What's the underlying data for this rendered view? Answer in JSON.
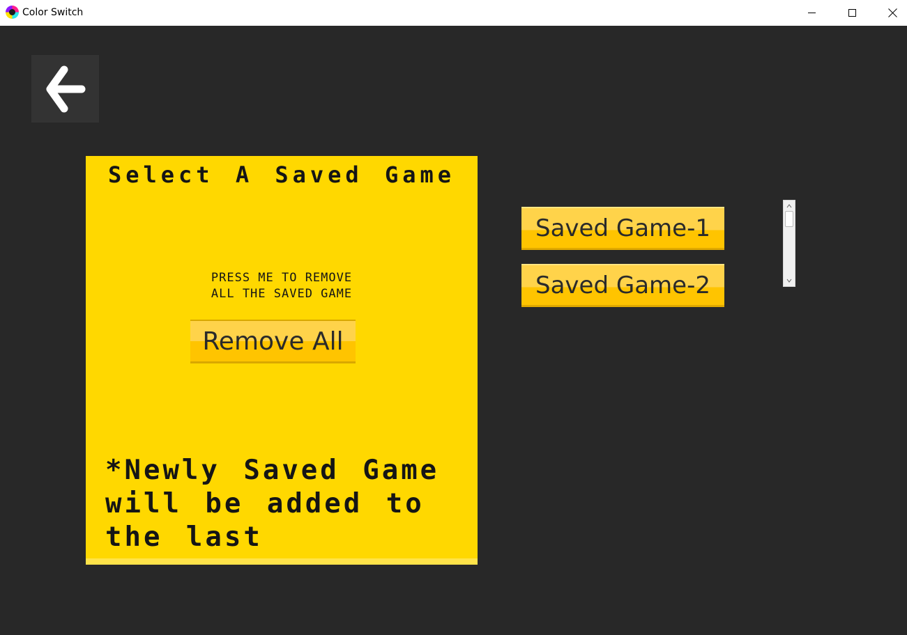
{
  "window": {
    "title": "Color Switch",
    "icon": "color-wheel-icon",
    "controls": [
      "minimize",
      "maximize",
      "close"
    ]
  },
  "back_button": {
    "icon": "back-arrow-icon"
  },
  "panel": {
    "title": "Select A Saved Game",
    "remove_hint_line1": "PRESS ME TO REMOVE",
    "remove_hint_line2": "ALL THE SAVED GAME",
    "remove_all_label": "Remove All",
    "note_line1": "*Newly Saved Game",
    "note_line2": "will be added to",
    "note_line3": "the last",
    "color": "#ffd800"
  },
  "saved_games": [
    {
      "label": "Saved Game-1"
    },
    {
      "label": "Saved Game-2"
    }
  ],
  "colors": {
    "background": "#282828",
    "button_accent": "#ffc400",
    "text": "#151515"
  }
}
